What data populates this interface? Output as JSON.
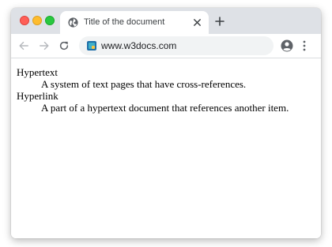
{
  "browser": {
    "tab": {
      "title": "Title of the document",
      "icon": "globe-icon",
      "close_icon": "close-icon"
    },
    "new_tab_icon": "plus-icon",
    "toolbar": {
      "back_icon": "arrow-left-icon",
      "forward_icon": "arrow-right-icon",
      "reload_icon": "reload-icon",
      "url": "www.w3docs.com",
      "profile_icon": "account-circle-icon",
      "menu_icon": "kebab-menu-icon"
    },
    "colors": {
      "tabstrip": "#dee1e6",
      "omnibox": "#f1f3f4",
      "traffic_close": "#ff5f57",
      "traffic_minimize": "#febc2e",
      "traffic_maximize": "#28c840"
    }
  },
  "page": {
    "definitions": [
      {
        "term": "Hypertext",
        "description": "A system of text pages that have cross-references."
      },
      {
        "term": "Hyperlink",
        "description": "A part of a hypertext document that references another item."
      }
    ]
  }
}
